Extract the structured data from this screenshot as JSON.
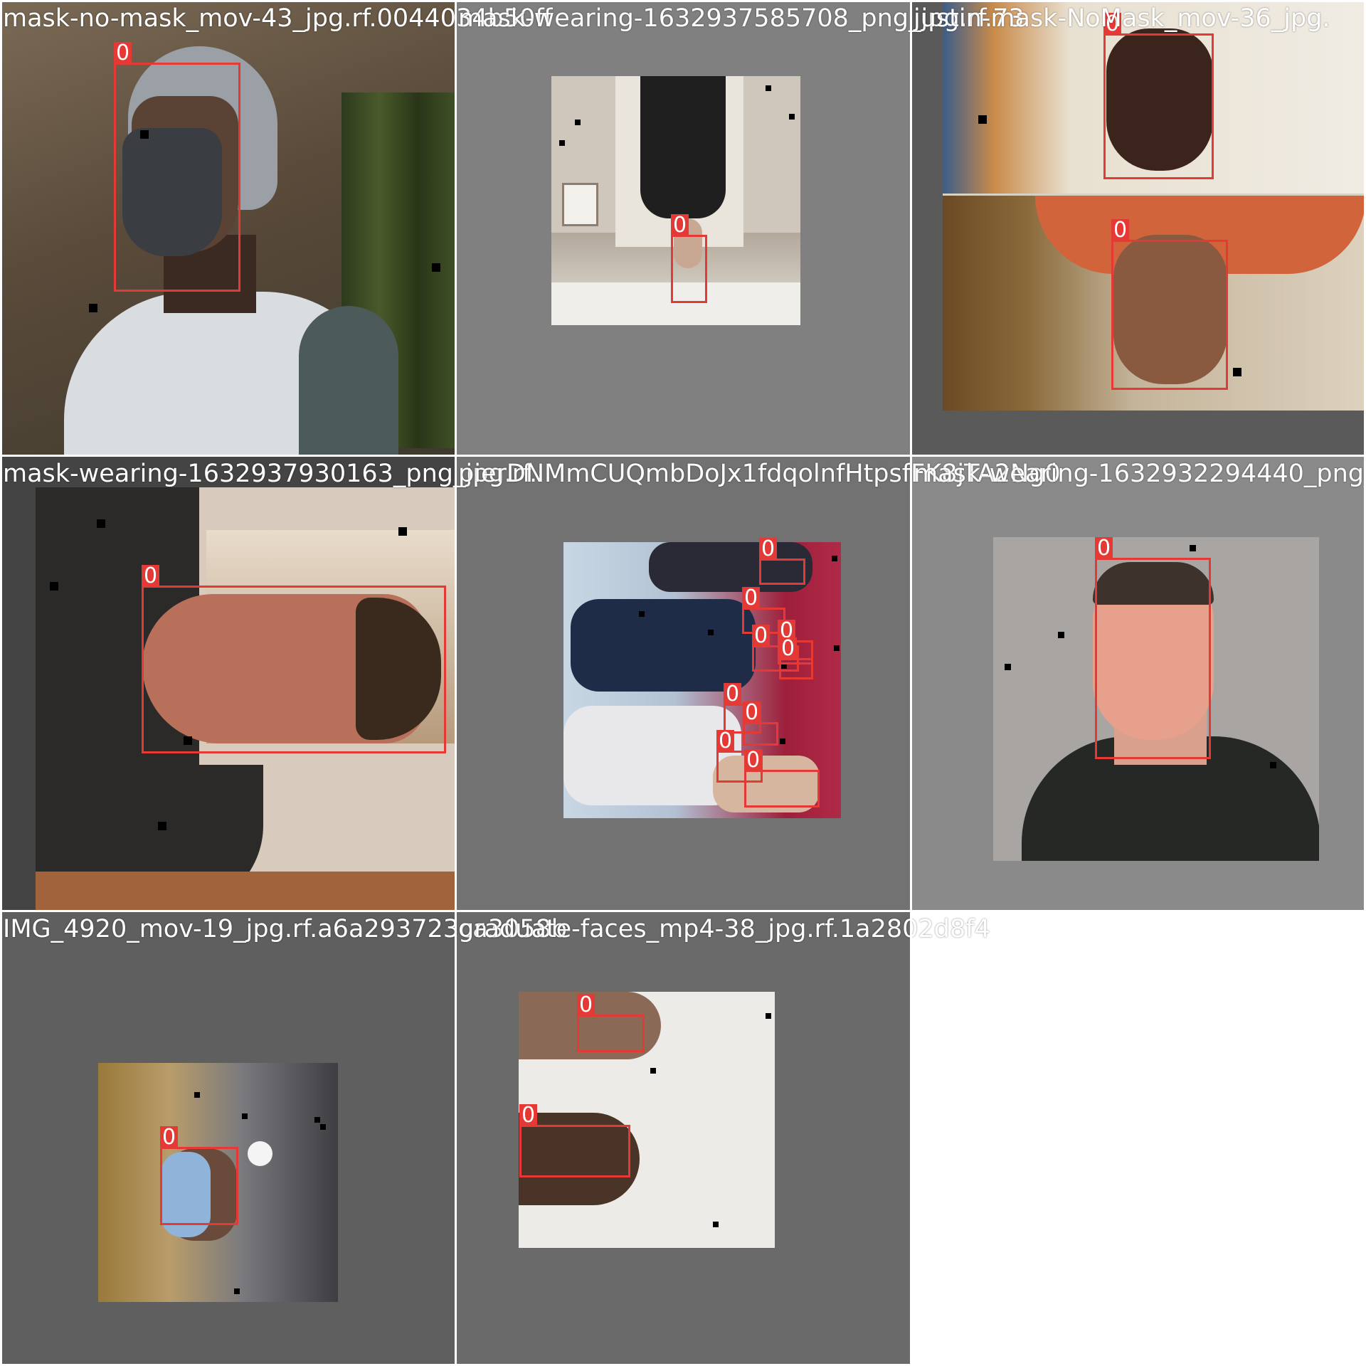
{
  "mosaic": {
    "box_color": "#e53935",
    "tiles": [
      {
        "title": "mask-no-mask_mov-43_jpg.rf.0044034b50ff",
        "pad_color": "#6b5a47",
        "boxes": [
          {
            "class_label": "0"
          }
        ]
      },
      {
        "title": "mask-wearing-1632937585708_png_jpg.rf.73",
        "pad_color": "#808080",
        "boxes": [
          {
            "class_label": "0"
          }
        ]
      },
      {
        "title": "justin-mask-NoMask_mov-36_jpg.",
        "pad_color": "#5a5a5a",
        "boxes": [
          {
            "class_label": "0"
          },
          {
            "class_label": "0"
          }
        ]
      },
      {
        "title": "mask-wearing-1632937930163_png_jpg.rf.",
        "pad_color": "#444444",
        "boxes": [
          {
            "class_label": "0"
          }
        ]
      },
      {
        "title": "pierDNMmCUQmbDoJx1fdqolnfHtpsfFK8jTA2Ng0",
        "pad_color": "#727272",
        "boxes": [
          {
            "class_label": "0"
          },
          {
            "class_label": "0"
          },
          {
            "class_label": "0"
          },
          {
            "class_label": "0"
          },
          {
            "class_label": "0"
          },
          {
            "class_label": "0"
          },
          {
            "class_label": "0"
          },
          {
            "class_label": "0"
          },
          {
            "class_label": "0"
          }
        ]
      },
      {
        "title": "mask-wearing-1632932294440_png_j",
        "pad_color": "#8a8a8a",
        "boxes": [
          {
            "class_label": "0"
          }
        ]
      },
      {
        "title": "IMG_4920_mov-19_jpg.rf.a6a293723ca3058b",
        "pad_color": "#5f5f5f",
        "boxes": [
          {
            "class_label": "0"
          }
        ]
      },
      {
        "title": "graduate-faces_mp4-38_jpg.rf.1a2802d8f4",
        "pad_color": "#6a6a6a",
        "boxes": [
          {
            "class_label": "0"
          },
          {
            "class_label": "0"
          }
        ]
      }
    ]
  }
}
